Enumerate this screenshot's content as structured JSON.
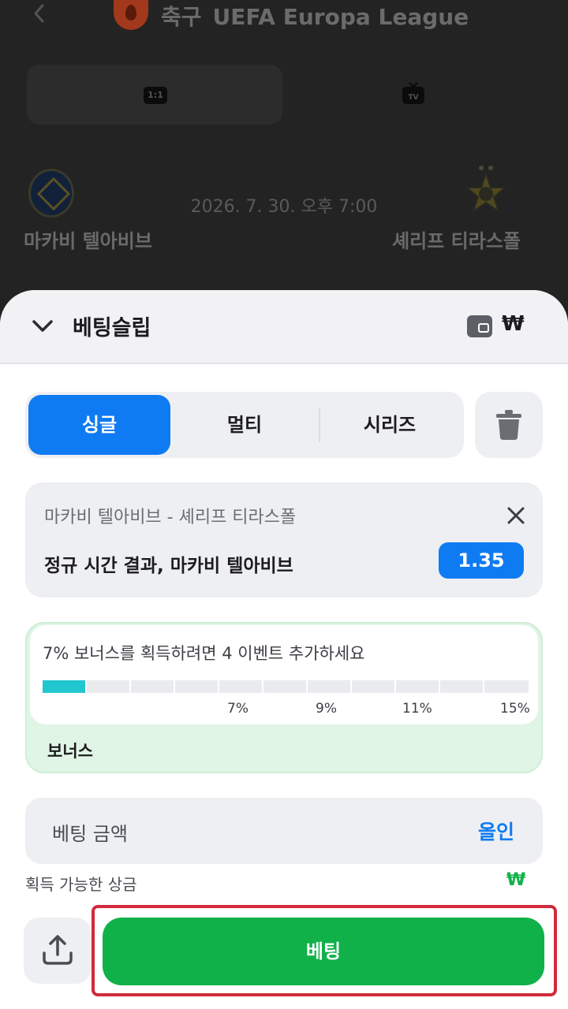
{
  "match": {
    "sport": "축구",
    "league": "UEFA Europa League",
    "h2h_label": "1:1",
    "home_team": "마카비 텔아비브",
    "away_team": "셰리프 티라스폴",
    "datetime": "2026. 7. 30. 오후 7:00"
  },
  "slip": {
    "title": "베팅슬립",
    "currency_symbol": "₩",
    "tabs": [
      {
        "label": "싱글",
        "active": true
      },
      {
        "label": "멀티",
        "active": false
      },
      {
        "label": "시리즈",
        "active": false
      }
    ],
    "bet": {
      "event": "마카비 텔아비브 - 셰리프 티라스폴",
      "market": "정규 시간 결과, 마카비 텔아비브",
      "odds": "1.35"
    },
    "bonus": {
      "message": "7% 보너스를 획득하려면 4 이벤트 추가하세요",
      "progress_fraction": 0.0909,
      "ticks": [
        "7%",
        "9%",
        "11%",
        "15%"
      ],
      "label": "보너스"
    },
    "amount": {
      "label": "베팅 금액",
      "all_in": "올인"
    },
    "payout": {
      "label": "획득 가능한 상금",
      "value": "₩"
    },
    "bet_button": "베팅"
  },
  "colors": {
    "accent_blue": "#0f7bf2",
    "accent_green": "#11b14a",
    "bonus_fill": "#21c7cf",
    "highlight_red": "#d22a3a"
  },
  "icons": [
    "back-icon",
    "sport-logo",
    "h2h-icon",
    "tv-icon",
    "chevron-down-icon",
    "wallet-icon",
    "trash-icon",
    "close-icon",
    "share-icon"
  ]
}
